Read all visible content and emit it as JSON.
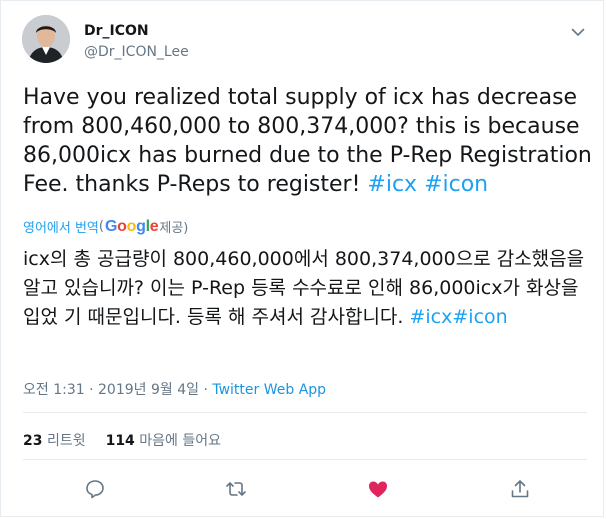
{
  "author": {
    "display_name": "Dr_ICON",
    "handle": "@Dr_ICON_Lee"
  },
  "tweet": {
    "text": "Have you realized total supply of icx has decrease from 800,460,000 to 800,374,000? this is because 86,000icx has burned due to the P-Rep Registration Fee. thanks P-Reps to register! ",
    "hashtag_1": "#icx",
    "hashtag_2": "#icon"
  },
  "translation": {
    "label": "영어에서 번역",
    "paren_open": "(",
    "google": [
      "G",
      "o",
      "o",
      "g",
      "l",
      "e"
    ],
    "suffix": " 제공)",
    "text": "icx의 총 공급량이 800,460,000에서 800,374,000으로 감소했음을 알고 있습니까? 이는 P-Rep 등록 수수료로 인해 86,000icx가 화상을 입었 기 때문입니다. 등록 해 주셔서 감사합니다. ",
    "hashtags": "#icx#icon"
  },
  "meta": {
    "time": "오전 1:31",
    "sep1": " · ",
    "date": "2019년 9월 4일",
    "sep2": " · ",
    "app": "Twitter Web App"
  },
  "stats": {
    "retweet_count": "23",
    "retweet_label": "리트윗",
    "like_count": "114",
    "like_label": "마음에 들어요"
  },
  "colors": {
    "link": "#1da1f2",
    "like_active": "#e0245e",
    "secondary": "#657786"
  },
  "icons": [
    "chevron-down-icon",
    "reply-icon",
    "retweet-icon",
    "heart-icon",
    "share-icon"
  ]
}
